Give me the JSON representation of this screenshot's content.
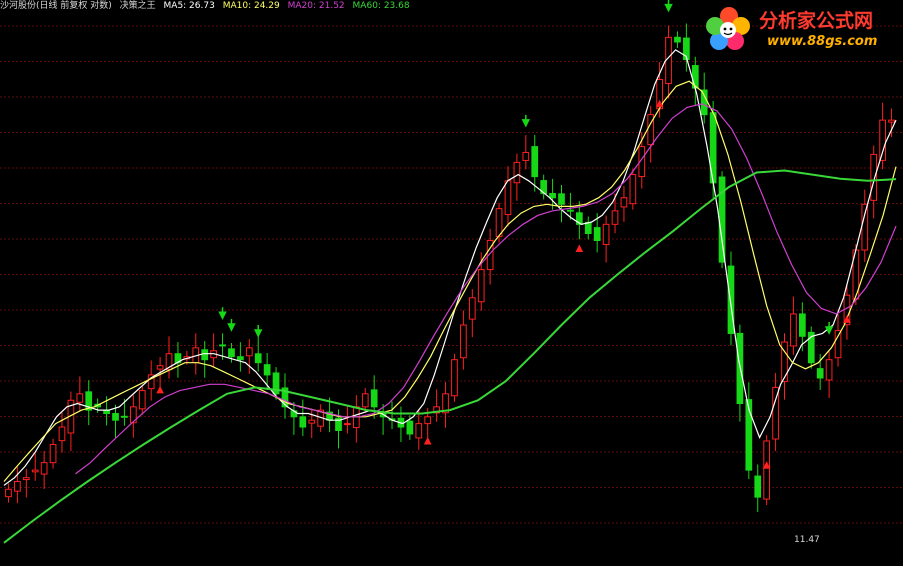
{
  "header": {
    "title": "沙河股份(日线 前复权 对数)",
    "indicator": "决策之王",
    "ma5_label": "MA5: 26.73",
    "ma10_label": "MA10: 24.29",
    "ma20_label": "MA20: 21.52",
    "ma60_label": "MA60: 23.68"
  },
  "watermark": {
    "site_name": "分析家公式网",
    "url": "www.88gs.com"
  },
  "colors": {
    "up": "#ff2020",
    "down": "#16d816",
    "ma5": "#ffffff",
    "ma10": "#ffff66",
    "ma20": "#d040d0",
    "ma60": "#38d838",
    "grid": "#7a1010"
  },
  "chart_data": {
    "type": "candlestick",
    "scale": "log",
    "ylim": [
      11.0,
      33.0
    ],
    "low_label": "11.47",
    "closes": [
      12.6,
      12.8,
      12.9,
      13.1,
      13.3,
      13.8,
      14.3,
      15.1,
      15.3,
      14.8,
      14.9,
      14.7,
      14.5,
      14.6,
      14.9,
      15.4,
      15.9,
      16.2,
      16.6,
      16.3,
      16.5,
      16.8,
      16.4,
      16.7,
      16.9,
      16.5,
      16.4,
      16.8,
      16.3,
      15.9,
      15.3,
      14.9,
      14.6,
      14.3,
      14.5,
      14.8,
      14.5,
      14.2,
      14.4,
      14.9,
      15.3,
      14.9,
      14.6,
      14.5,
      14.3,
      14.1,
      14.4,
      14.6,
      14.9,
      15.3,
      16.4,
      17.6,
      18.6,
      19.7,
      20.9,
      22.3,
      23.6,
      24.5,
      25.0,
      23.8,
      23.0,
      22.8,
      22.5,
      22.2,
      21.6,
      21.2,
      20.9,
      21.6,
      22.2,
      22.8,
      23.9,
      25.3,
      27.0,
      29.0,
      31.6,
      31.3,
      30.2,
      28.5,
      27.0,
      23.5,
      20.0,
      17.3,
      15.0,
      13.1,
      12.4,
      13.9,
      15.5,
      17.0,
      18.0,
      17.2,
      16.3,
      15.8,
      16.4,
      17.4,
      18.7,
      20.5,
      22.5,
      24.9,
      26.7,
      26.7
    ],
    "series": [
      {
        "name": "MA5",
        "values": [
          12.7,
          12.9,
          13.2,
          13.6,
          14.1,
          14.6,
          14.9,
          15.0,
          14.9,
          14.8,
          14.8,
          14.9,
          15.2,
          15.5,
          15.8,
          16.0,
          16.2,
          16.4,
          16.5,
          16.6,
          16.6,
          16.5,
          16.4,
          16.3,
          16.0,
          15.6,
          15.2,
          14.9,
          14.7,
          14.7,
          14.6,
          14.5,
          14.5,
          14.6,
          14.7,
          14.8,
          14.7,
          14.5,
          14.4,
          14.6,
          15.0,
          15.9,
          17.0,
          18.2,
          19.4,
          20.6,
          21.7,
          22.8,
          23.6,
          23.9,
          23.6,
          23.2,
          22.8,
          22.3,
          21.9,
          21.6,
          21.7,
          22.0,
          22.6,
          23.6,
          25.0,
          26.8,
          28.7,
          30.1,
          30.8,
          30.4,
          28.2,
          25.3,
          22.3,
          19.1,
          16.4,
          14.8,
          14.0,
          14.6,
          15.6,
          16.2,
          16.9,
          17.2,
          17.3,
          17.6,
          18.6,
          20.2,
          22.0,
          23.8,
          25.5,
          26.7
        ]
      },
      {
        "name": "MA10",
        "values": [
          12.8,
          13.2,
          13.6,
          14.0,
          14.4,
          14.6,
          14.8,
          14.9,
          15.1,
          15.3,
          15.5,
          15.7,
          15.9,
          16.1,
          16.3,
          16.3,
          16.2,
          16.0,
          15.8,
          15.6,
          15.4,
          15.2,
          15.0,
          14.9,
          14.8,
          14.7,
          14.6,
          14.6,
          14.6,
          14.7,
          14.8,
          15.2,
          15.8,
          16.5,
          17.4,
          18.3,
          19.2,
          20.1,
          20.9,
          21.6,
          22.1,
          22.4,
          22.5,
          22.4,
          22.4,
          22.5,
          22.8,
          23.3,
          24.1,
          25.2,
          26.5,
          27.7,
          28.6,
          28.9,
          28.3,
          26.9,
          24.9,
          22.6,
          20.3,
          18.3,
          16.9,
          16.3,
          16.1,
          16.3,
          16.8,
          17.6,
          18.8,
          20.3,
          22.0,
          24.29
        ]
      },
      {
        "name": "MA20",
        "values": [
          13.0,
          13.3,
          13.7,
          14.1,
          14.5,
          14.9,
          15.2,
          15.4,
          15.5,
          15.6,
          15.6,
          15.5,
          15.4,
          15.3,
          15.1,
          14.9,
          14.8,
          14.7,
          14.6,
          14.6,
          14.7,
          15.0,
          15.5,
          16.3,
          17.2,
          18.1,
          19.0,
          19.8,
          20.5,
          21.1,
          21.6,
          22.0,
          22.2,
          22.3,
          22.4,
          22.6,
          23.0,
          23.7,
          24.7,
          25.8,
          26.8,
          27.4,
          27.6,
          27.2,
          26.2,
          24.7,
          23.0,
          21.3,
          19.9,
          18.8,
          18.2,
          18.0,
          18.3,
          19.0,
          20.0,
          21.52
        ]
      },
      {
        "name": "MA60",
        "values": [
          11.3,
          11.8,
          12.3,
          12.8,
          13.3,
          13.8,
          14.3,
          14.8,
          15.3,
          15.5,
          15.4,
          15.2,
          15.0,
          14.8,
          14.7,
          14.7,
          14.8,
          15.1,
          15.7,
          16.6,
          17.6,
          18.6,
          19.5,
          20.4,
          21.3,
          22.3,
          23.3,
          24.0,
          24.1,
          23.9,
          23.7,
          23.6,
          23.68
        ]
      }
    ],
    "signals": [
      {
        "type": "down",
        "bar": 24
      },
      {
        "type": "down",
        "bar": 25
      },
      {
        "type": "down",
        "bar": 28
      },
      {
        "type": "down",
        "bar": 58
      },
      {
        "type": "down",
        "bar": 74
      },
      {
        "type": "down",
        "bar": 92
      },
      {
        "type": "up",
        "bar": 17
      },
      {
        "type": "up",
        "bar": 47
      },
      {
        "type": "up",
        "bar": 64
      },
      {
        "type": "up",
        "bar": 73
      },
      {
        "type": "up",
        "bar": 85
      },
      {
        "type": "up",
        "bar": 94
      }
    ],
    "grid": "horizontal-dashed"
  }
}
